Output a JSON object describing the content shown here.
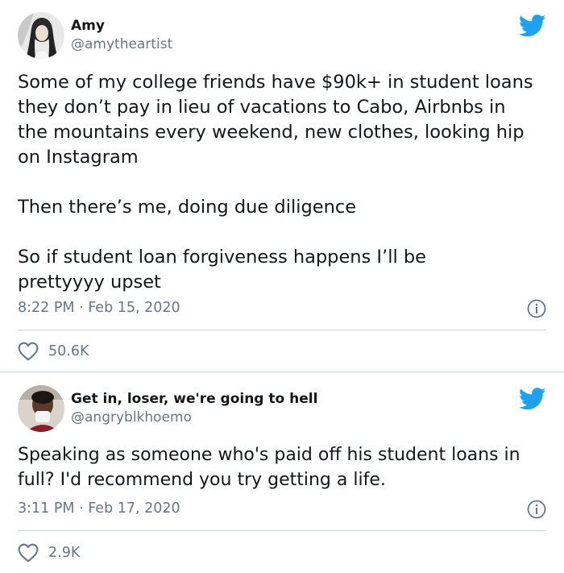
{
  "tweets": [
    {
      "name": "Amy",
      "handle": "@amytheartist",
      "paragraphs": [
        "Some of my college friends have $90k+ in student loans they don’t pay in lieu of vacations to Cabo, Airbnbs in the mountains every weekend, new clothes, looking hip on Instagram",
        "Then there’s me, doing due diligence",
        "So if student loan forgiveness happens I’ll be prettyyyy upset"
      ],
      "timestamp": "8:22 PM · Feb 15, 2020",
      "likes": "50.6K"
    },
    {
      "name": "Get in, loser, we're going to hell",
      "handle": "@angryblkhoemo",
      "paragraphs": [
        "Speaking as someone who's paid off his student loans in full? I'd recommend you try getting a life."
      ],
      "timestamp": "3:11 PM · Feb 17, 2020",
      "likes": "2.9K"
    }
  ],
  "colors": {
    "twitter_blue": "#1da1f2",
    "secondary_text": "#657786",
    "primary_text": "#14171a",
    "divider": "#ccd6dd"
  },
  "icons": [
    "twitter-bird-icon",
    "info-icon",
    "heart-icon"
  ]
}
